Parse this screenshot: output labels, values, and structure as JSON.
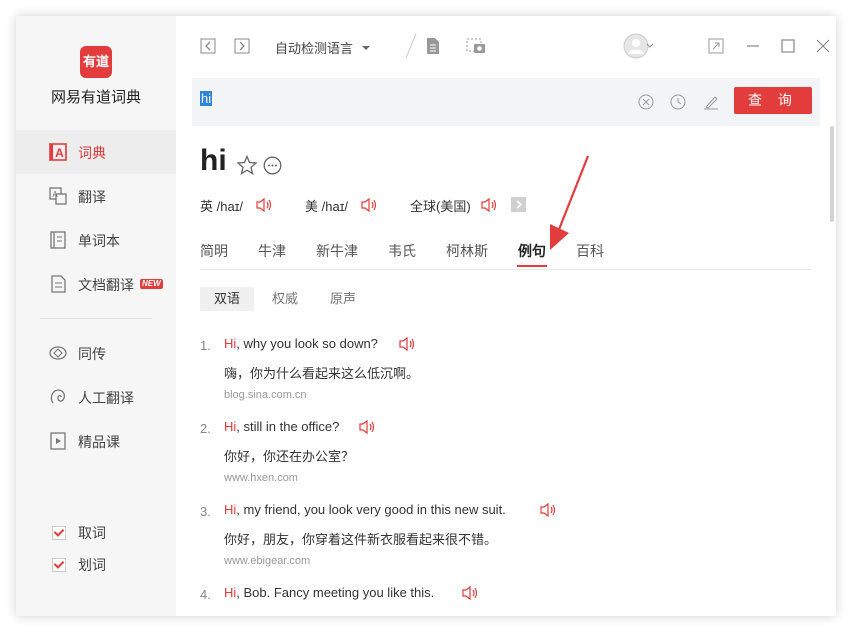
{
  "app": {
    "logo_text": "有道",
    "name": "网易有道词典"
  },
  "sidebar": {
    "items": [
      {
        "label": "词典",
        "icon": "dict-icon",
        "active": true
      },
      {
        "label": "翻译",
        "icon": "translate-icon"
      },
      {
        "label": "单词本",
        "icon": "wordbook-icon"
      },
      {
        "label": "文档翻译",
        "icon": "document-icon",
        "badge": "NEW"
      },
      {
        "label": "同传",
        "icon": "simultaneous-icon"
      },
      {
        "label": "人工翻译",
        "icon": "human-translate-icon"
      },
      {
        "label": "精品课",
        "icon": "course-icon"
      }
    ],
    "checks": [
      {
        "label": "取词",
        "checked": true
      },
      {
        "label": "划词",
        "checked": true
      }
    ]
  },
  "toolbar": {
    "language": "自动检测语言"
  },
  "search": {
    "query": "hi",
    "button": "查 询"
  },
  "entry": {
    "word": "hi",
    "pronunciations": [
      {
        "region": "英",
        "ipa": "/haɪ/"
      },
      {
        "region": "美",
        "ipa": "/haɪ/"
      },
      {
        "region": "全球(美国)",
        "ipa": ""
      }
    ]
  },
  "tabs": [
    "简明",
    "牛津",
    "新牛津",
    "韦氏",
    "柯林斯",
    "例句",
    "百科"
  ],
  "active_tab": "例句",
  "subtabs": [
    "双语",
    "权威",
    "原声"
  ],
  "active_subtab": "双语",
  "examples": [
    {
      "num": "1.",
      "hl": "Hi",
      "rest": ", why you look so down?",
      "cn": "嗨，你为什么看起来这么低沉啊。",
      "src": "blog.sina.com.cn"
    },
    {
      "num": "2.",
      "hl": "Hi",
      "rest": ", still in the office?",
      "cn": "你好，你还在办公室？",
      "src": "www.hxen.com"
    },
    {
      "num": "3.",
      "hl": "Hi",
      "rest": ", my friend, you look very good in this new suit.",
      "cn": "你好，朋友，你穿着这件新衣服看起来很不错。",
      "src": "www.ebigear.com"
    },
    {
      "num": "4.",
      "hl": "Hi",
      "rest": ", Bob. Fancy meeting you like this.",
      "cn": "",
      "src": ""
    }
  ],
  "colors": {
    "accent": "#e23c3c",
    "selection": "#2f84d8",
    "sidebar_bg": "#f6f6f6",
    "search_bg": "#f3f4f6"
  }
}
